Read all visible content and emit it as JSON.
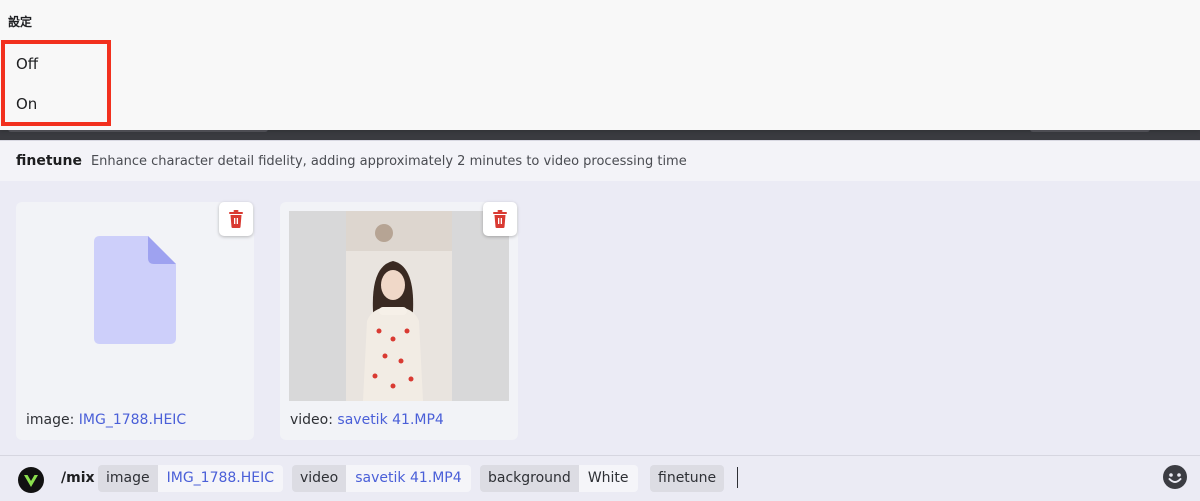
{
  "menu": {
    "header": "設定",
    "options": [
      "Off",
      "On"
    ]
  },
  "option_info": {
    "name": "finetune",
    "description": "Enhance character detail fidelity, adding approximately 2 minutes to video processing time"
  },
  "attachments": [
    {
      "type_label": "image:",
      "filename": "IMG_1788.HEIC"
    },
    {
      "type_label": "video:",
      "filename": "savetik 41.MP4"
    }
  ],
  "command": {
    "name": "/mix",
    "params": [
      {
        "key": "image",
        "value": "IMG_1788.HEIC"
      },
      {
        "key": "video",
        "value": "savetik 41.MP4"
      },
      {
        "key": "background",
        "value": "White"
      },
      {
        "key": "finetune",
        "value": ""
      }
    ]
  },
  "icons": {
    "delete": "trash-icon",
    "file": "file-icon",
    "app": "app-logo-icon",
    "emoji": "emoji-icon"
  },
  "colors": {
    "highlight": "#f2301e",
    "link": "#4a5fd8",
    "delete": "#d93a32",
    "file_icon": "#cdcffa"
  }
}
